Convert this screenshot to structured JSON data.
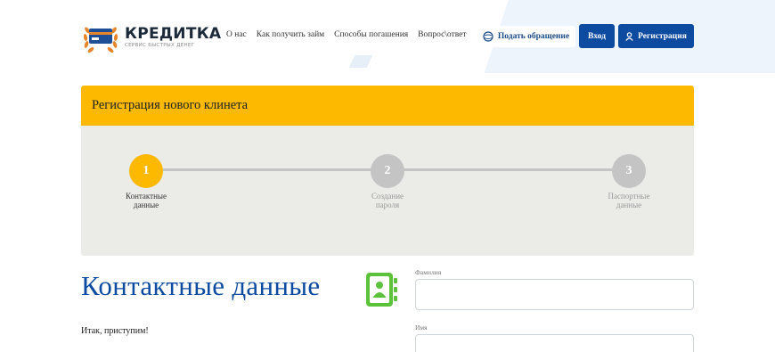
{
  "header": {
    "logo_title": "КРЕДИТКА",
    "logo_subtitle": "СЕРВИС БЫСТРЫХ ДЕНЕГ",
    "nav": [
      "О нас",
      "Как получить займ",
      "Способы погашения",
      "Вопрос\\ответ"
    ],
    "appeal_button": "Подать обращение",
    "login_button": "Вход",
    "register_button": "Регистрация"
  },
  "registration": {
    "title": "Регистрация нового клинета",
    "steps": [
      {
        "number": "1",
        "label_line1": "Контактные",
        "label_line2": "данные",
        "active": true
      },
      {
        "number": "2",
        "label_line1": "Создание",
        "label_line2": "пароля",
        "active": false
      },
      {
        "number": "3",
        "label_line1": "Паспортные",
        "label_line2": "данные",
        "active": false
      }
    ]
  },
  "contact": {
    "heading": "Контактные данные",
    "intro": "Итак, приступим!",
    "fields": [
      {
        "label": "Фамилия",
        "value": ""
      },
      {
        "label": "Имя",
        "value": ""
      }
    ]
  },
  "colors": {
    "accent_yellow": "#fcb900",
    "brand_blue": "#0d4ba0",
    "icon_green": "#5cc13b",
    "inactive_step": "#c4c4c4"
  },
  "icons": {
    "appeal": "support-globe-icon",
    "register": "user-icon",
    "contact": "address-book-icon"
  }
}
